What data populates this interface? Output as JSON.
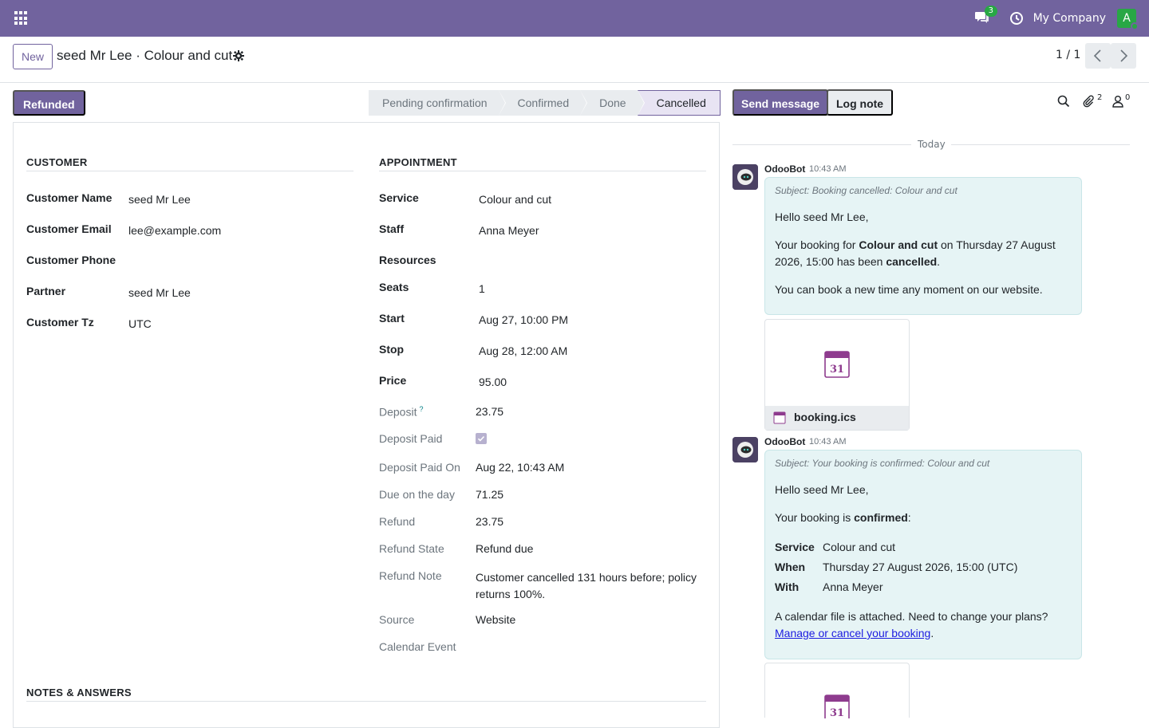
{
  "navbar": {
    "chat_count": "3",
    "company": "My Company",
    "avatar_letter": "A",
    "brand_color": "#71639e"
  },
  "control": {
    "new_label": "New",
    "title": "seed Mr Lee · Colour and cut",
    "pager": "1 / 1"
  },
  "status": {
    "refunded_label": "Refunded",
    "stages": [
      "Pending confirmation",
      "Confirmed",
      "Done",
      "Cancelled"
    ],
    "active_stage": "Cancelled"
  },
  "customer": {
    "title": "CUSTOMER",
    "fields": [
      {
        "label": "Customer Name",
        "value": "seed Mr Lee"
      },
      {
        "label": "Customer Email",
        "value": "lee@example.com"
      },
      {
        "label": "Customer Phone",
        "value": ""
      },
      {
        "label": "Partner",
        "value": "seed Mr Lee"
      },
      {
        "label": "Customer Tz",
        "value": "UTC"
      }
    ]
  },
  "appointment": {
    "title": "APPOINTMENT",
    "fields": [
      {
        "label": "Service",
        "value": "Colour and cut"
      },
      {
        "label": "Staff",
        "value": "Anna Meyer"
      },
      {
        "label": "Resources",
        "value": ""
      },
      {
        "label": "Seats",
        "value": "1"
      },
      {
        "label": "Start",
        "value": "Aug 27, 10:00 PM"
      },
      {
        "label": "Stop",
        "value": "Aug 28, 12:00 AM"
      },
      {
        "label": "Price",
        "value": "95.00"
      },
      {
        "label": "Deposit",
        "value": "23.75",
        "help": "?"
      },
      {
        "label": "Deposit Paid",
        "value": true
      },
      {
        "label": "Deposit Paid On",
        "value": "Aug 22, 10:43 AM"
      },
      {
        "label": "Due on the day",
        "value": "71.25"
      },
      {
        "label": "Refund",
        "value": "23.75"
      },
      {
        "label": "Refund State",
        "value": "Refund due"
      },
      {
        "label": "Refund Note",
        "value": "Customer cancelled 131 hours before; policy returns 100%."
      },
      {
        "label": "Source",
        "value": "Website"
      },
      {
        "label": "Calendar Event",
        "value": ""
      }
    ]
  },
  "notes": {
    "title": "NOTES & ANSWERS"
  },
  "chatter": {
    "send_label": "Send message",
    "log_label": "Log note",
    "attachments_count": "2",
    "followers_count": "0",
    "today_label": "Today",
    "messages": [
      {
        "author": "OdooBot",
        "time": "10:43 AM",
        "subject": "Subject: Booking cancelled: Colour and cut",
        "greeting": "Hello seed Mr Lee,",
        "body_pre": "Your booking for ",
        "body_service": "Colour and cut",
        "body_mid": " on Thursday 27 August 2026, 15:00 has been ",
        "body_state": "cancelled",
        "body_post": ".",
        "footer": "You can book a new time any moment on our website.",
        "attachment": {
          "name": "booking.ics",
          "icon_day": "31"
        }
      },
      {
        "author": "OdooBot",
        "time": "10:43 AM",
        "subject": "Subject: Your booking is confirmed: Colour and cut",
        "greeting": "Hello seed Mr Lee,",
        "body_pre": "Your booking is ",
        "body_state": "confirmed",
        "body_post": ":",
        "details": [
          {
            "k": "Service",
            "v": "Colour and cut"
          },
          {
            "k": "When",
            "v": "Thursday 27 August 2026, 15:00 (UTC)"
          },
          {
            "k": "With",
            "v": "Anna Meyer"
          }
        ],
        "calendar_note": "A calendar file is attached. Need to change your plans?",
        "link_text": "Manage or cancel your booking",
        "link_post": ".",
        "attachment": {
          "icon_day": "31"
        }
      }
    ]
  }
}
